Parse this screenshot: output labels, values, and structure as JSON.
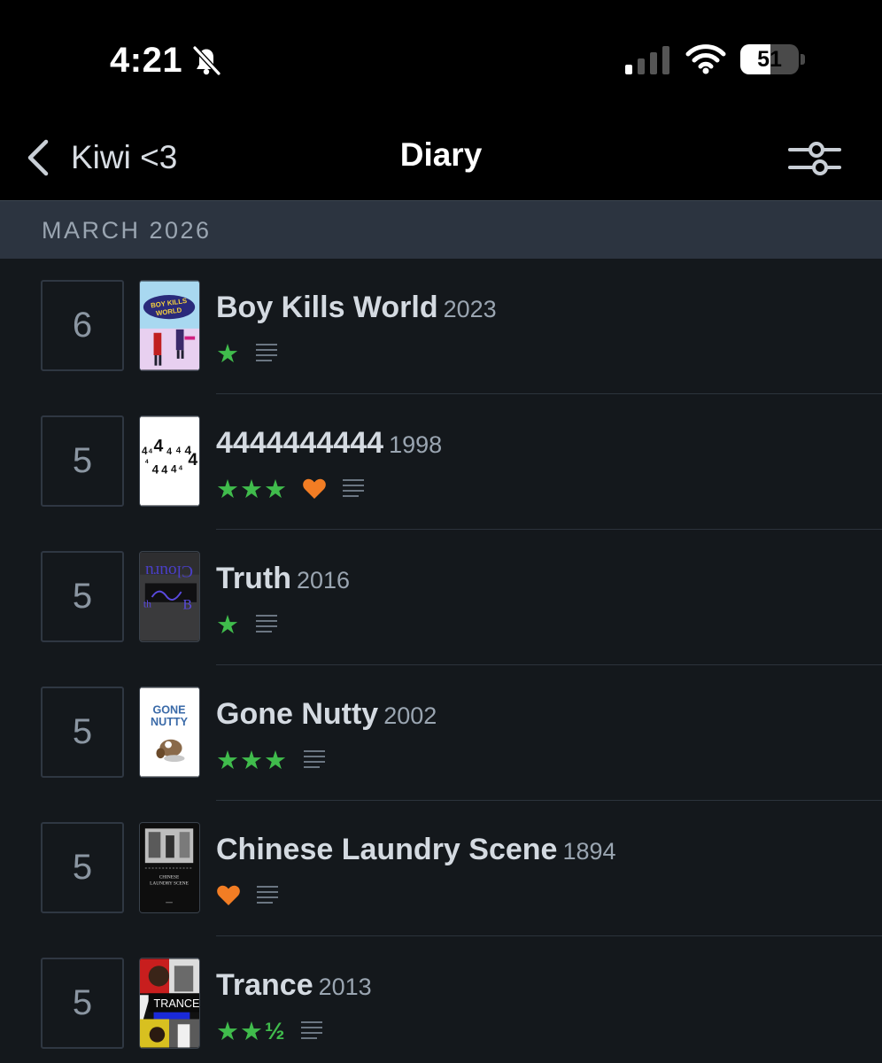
{
  "status_bar": {
    "time": "4:21",
    "battery_level": "51",
    "battery_fraction": 0.51,
    "icons": [
      "bell-slash-icon",
      "cellular-signal-icon",
      "wifi-icon",
      "battery-icon"
    ]
  },
  "nav": {
    "back_label": "Kiwi <3",
    "title": "Diary",
    "filter_icon": "sliders-icon"
  },
  "section": {
    "label": "MARCH 2026"
  },
  "entries": [
    {
      "day": "6",
      "title": "Boy Kills World",
      "year": "2023",
      "rating": "★",
      "rating_half": "",
      "liked": false,
      "has_review": true
    },
    {
      "day": "5",
      "title": "4444444444",
      "year": "1998",
      "rating": "★★★",
      "rating_half": "",
      "liked": true,
      "has_review": true
    },
    {
      "day": "5",
      "title": "Truth",
      "year": "2016",
      "rating": "★",
      "rating_half": "",
      "liked": false,
      "has_review": true
    },
    {
      "day": "5",
      "title": "Gone Nutty",
      "year": "2002",
      "rating": "★★★",
      "rating_half": "",
      "liked": false,
      "has_review": true
    },
    {
      "day": "5",
      "title": "Chinese Laundry Scene",
      "year": "1894",
      "rating": "",
      "rating_half": "",
      "liked": true,
      "has_review": true
    },
    {
      "day": "5",
      "title": "Trance",
      "year": "2013",
      "rating": "★★",
      "rating_half": "½",
      "liked": false,
      "has_review": true
    }
  ],
  "posters": {
    "boy_kills_world": "BOY KILLS WORLD",
    "gone_nutty": [
      "GONE",
      "NUTTY"
    ],
    "chinese_laundry": [
      "CHINESE",
      "LAUNDRY SCENE"
    ],
    "trance": "TRANCE"
  },
  "colors": {
    "star_green": "#40bc4c",
    "heart_orange": "#f27d24",
    "background": "#14181c",
    "section_bg": "#2c3440"
  }
}
